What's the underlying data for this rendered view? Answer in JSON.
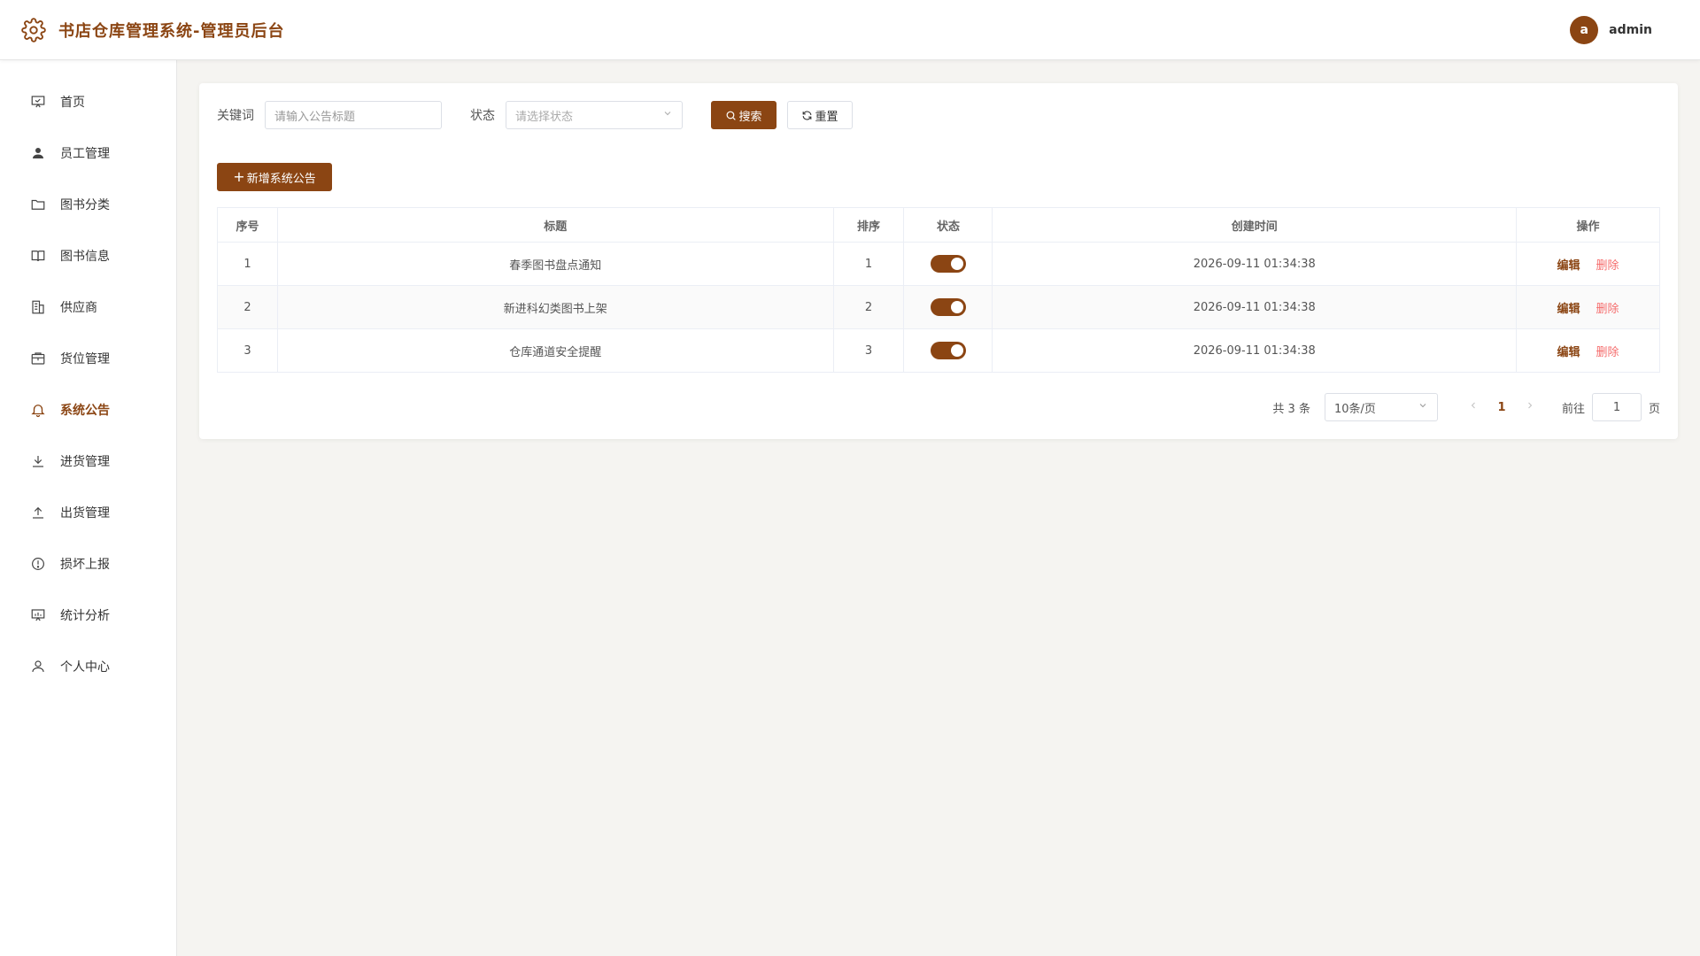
{
  "header": {
    "title": "书店仓库管理系统-管理员后台",
    "avatar_letter": "a",
    "username": "admin"
  },
  "sidebar": {
    "items": [
      {
        "label": "首页",
        "icon": "presentation-board-icon"
      },
      {
        "label": "员工管理",
        "icon": "user-icon"
      },
      {
        "label": "图书分类",
        "icon": "folder-icon"
      },
      {
        "label": "图书信息",
        "icon": "book-icon"
      },
      {
        "label": "供应商",
        "icon": "building-icon"
      },
      {
        "label": "货位管理",
        "icon": "package-icon"
      },
      {
        "label": "系统公告",
        "icon": "bell-icon",
        "active": true
      },
      {
        "label": "进货管理",
        "icon": "download-icon"
      },
      {
        "label": "出货管理",
        "icon": "upload-icon"
      },
      {
        "label": "损坏上报",
        "icon": "warning-circle-icon"
      },
      {
        "label": "统计分析",
        "icon": "chart-board-icon"
      },
      {
        "label": "个人中心",
        "icon": "user-outline-icon"
      }
    ]
  },
  "search": {
    "keyword_label": "关键词",
    "keyword_placeholder": "请输入公告标题",
    "status_label": "状态",
    "status_placeholder": "请选择状态",
    "search_button": "搜索",
    "reset_button": "重置"
  },
  "toolbar": {
    "add_button": "新增系统公告"
  },
  "table": {
    "headers": [
      "序号",
      "标题",
      "排序",
      "状态",
      "创建时间",
      "操作"
    ],
    "rows": [
      {
        "index": "1",
        "title": "春季图书盘点通知",
        "sort": "1",
        "status": true,
        "created": "2026-09-11 01:34:38"
      },
      {
        "index": "2",
        "title": "新进科幻类图书上架",
        "sort": "2",
        "status": true,
        "created": "2026-09-11 01:34:38"
      },
      {
        "index": "3",
        "title": "仓库通道安全提醒",
        "sort": "3",
        "status": true,
        "created": "2026-09-11 01:34:38"
      }
    ],
    "edit_label": "编辑",
    "delete_label": "删除"
  },
  "pagination": {
    "total_text": "共 3 条",
    "page_size": "10条/页",
    "current_page": "1",
    "goto_label": "前往",
    "goto_value": "1",
    "page_suffix": "页"
  },
  "colors": {
    "primary": "#8b4513",
    "danger": "#f56c6c"
  }
}
